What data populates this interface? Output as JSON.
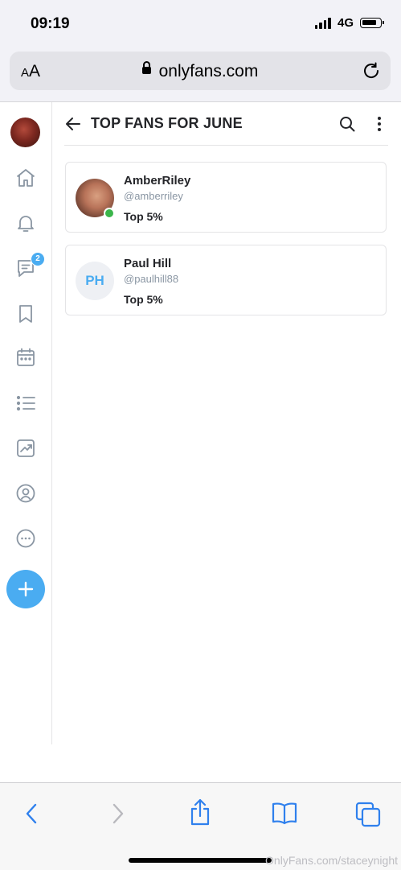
{
  "status": {
    "time": "09:19",
    "network": "4G"
  },
  "browser": {
    "text_size_label": "AA",
    "url": "onlyfans.com"
  },
  "sidebar": {
    "messages_badge": "2"
  },
  "header": {
    "title": "TOP FANS FOR JUNE"
  },
  "fans": [
    {
      "name": "AmberRiley",
      "handle": "@amberriley",
      "rank": "Top 5%",
      "avatar": "photo",
      "online": true
    },
    {
      "name": "Paul Hill",
      "handle": "@paulhill88",
      "rank": "Top 5%",
      "avatar": "PH",
      "online": false
    }
  ],
  "watermark": "OnlyFans.com/staceynight",
  "colors": {
    "accent": "#4aacf1",
    "online": "#3bb54a",
    "text_secondary": "#8a96a3"
  },
  "icons": [
    "home-icon",
    "bell-icon",
    "messages-icon",
    "bookmark-icon",
    "calendar-icon",
    "list-icon",
    "statistics-icon",
    "profile-icon",
    "more-options-icon",
    "plus-icon",
    "search-icon",
    "back-arrow-icon",
    "kebab-menu-icon",
    "lock-icon",
    "reload-icon",
    "browser-back-icon",
    "browser-forward-icon",
    "share-icon",
    "bookmarks-icon",
    "tabs-icon"
  ]
}
